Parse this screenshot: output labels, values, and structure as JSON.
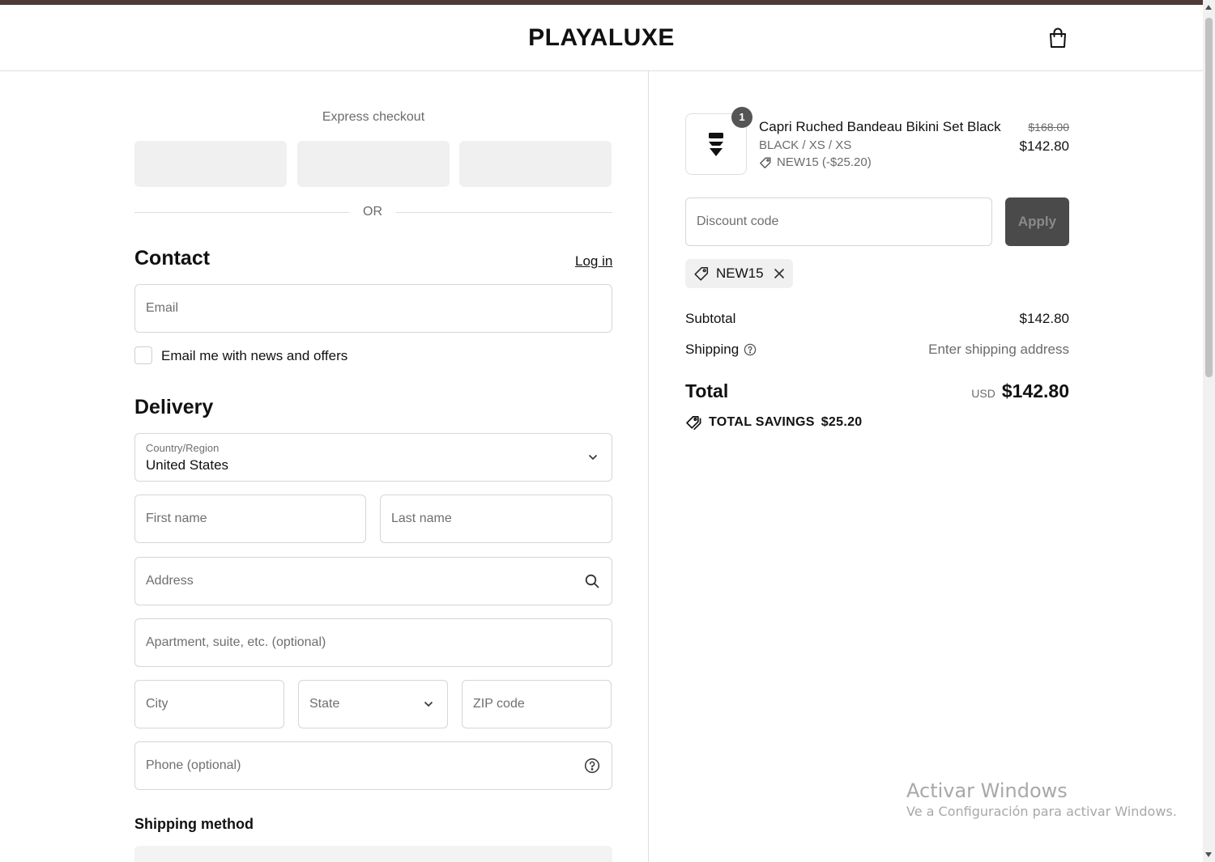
{
  "header": {
    "logo": "PLAYALUXE",
    "cart_icon": "shopping-bag-icon"
  },
  "express": {
    "label": "Express checkout",
    "or": "OR"
  },
  "contact": {
    "title": "Contact",
    "login": "Log in",
    "email_placeholder": "Email",
    "newsletter_label": "Email me with news and offers",
    "newsletter_checked": false
  },
  "delivery": {
    "title": "Delivery",
    "country_label": "Country/Region",
    "country_value": "United States",
    "first_name": "First name",
    "last_name": "Last name",
    "address": "Address",
    "apartment": "Apartment, suite, etc. (optional)",
    "city": "City",
    "state": "State",
    "zip": "ZIP code",
    "phone": "Phone (optional)"
  },
  "shipping_method": {
    "title": "Shipping method"
  },
  "order": {
    "item": {
      "quantity": "1",
      "name": "Capri Ruched Bandeau Bikini Set Black",
      "variant": "BLACK / XS / XS",
      "discount": "NEW15 (-$25.20)",
      "original_price": "$168.00",
      "price": "$142.80"
    },
    "discount_placeholder": "Discount code",
    "apply_label": "Apply",
    "applied_code": "NEW15",
    "subtotal_label": "Subtotal",
    "subtotal_value": "$142.80",
    "shipping_label": "Shipping",
    "shipping_value": "Enter shipping address",
    "total_label": "Total",
    "currency": "USD",
    "total_value": "$142.80",
    "savings_label": "TOTAL SAVINGS",
    "savings_value": "$25.20"
  },
  "watermark": {
    "title": "Activar Windows",
    "subtitle": "Ve a Configuración para activar Windows."
  },
  "colors": {
    "top_strip": "#4e3a36",
    "apply_button": "#4a4a4a"
  }
}
